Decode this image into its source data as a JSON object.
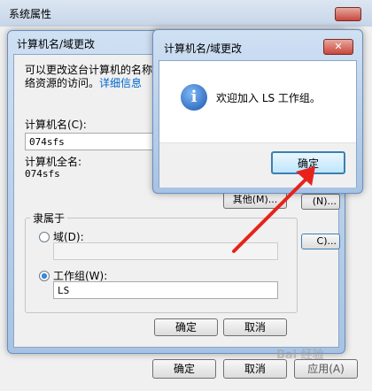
{
  "outer_window": {
    "title": "系统属性",
    "buttons": {
      "ok": "确定",
      "cancel": "取消",
      "apply": "应用(A)"
    }
  },
  "rename_dialog": {
    "title": "计算机名/域更改",
    "description_line1": "可以更改这台计算机的名称",
    "description_line2": "络资源的访问。",
    "details_link": "详细信息",
    "computer_name_label": "计算机名(C):",
    "computer_name_value": "074sfs",
    "full_name_label": "计算机全名:",
    "full_name_value": "074sfs",
    "other_button": "其他(M)...",
    "member_of_label": "隶属于",
    "domain_label": "域(D):",
    "domain_value": "",
    "workgroup_label": "工作组(W):",
    "workgroup_value": "LS",
    "ok": "确定",
    "cancel": "取消",
    "partial_btn_1": "(N)...",
    "partial_btn_2": "C)..."
  },
  "welcome_dialog": {
    "title": "计算机名/域更改",
    "message": "欢迎加入 LS 工作组。",
    "ok": "确定",
    "close_symbol": "✕"
  },
  "colors": {
    "arrow": "#e8221b",
    "link": "#0066cc",
    "close_button": "#c9463d"
  },
  "watermark": "Bai 经验"
}
